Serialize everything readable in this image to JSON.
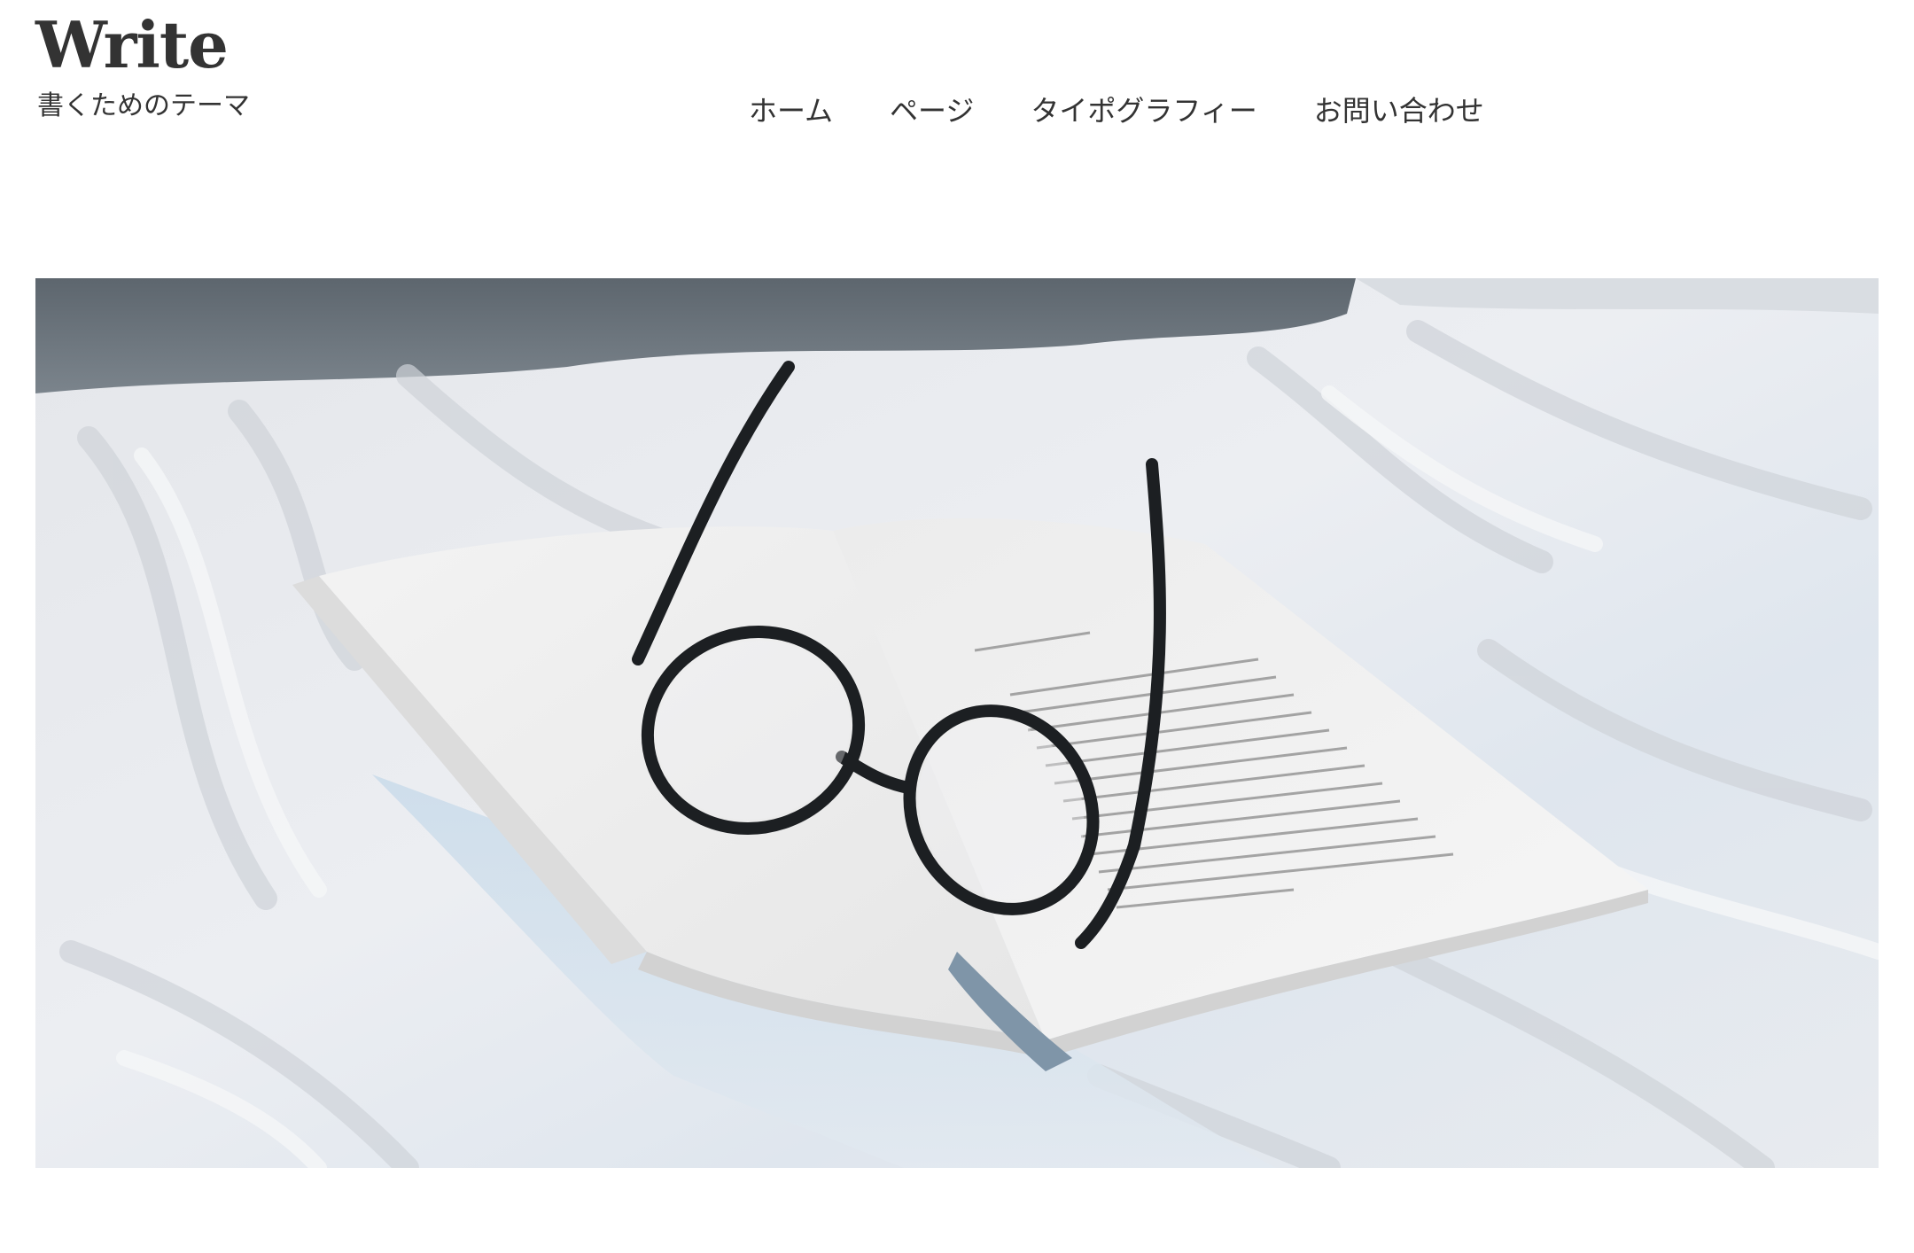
{
  "site": {
    "title": "Write",
    "description": "書くためのテーマ"
  },
  "nav": {
    "items": [
      {
        "label": "ホーム"
      },
      {
        "label": "ページ"
      },
      {
        "label": "タイポグラフィー"
      },
      {
        "label": "お問い合わせ"
      }
    ]
  },
  "hero": {
    "image_subject": "open book with eyeglasses on white bed sheets"
  },
  "colors": {
    "text": "#333333",
    "background": "#ffffff"
  }
}
